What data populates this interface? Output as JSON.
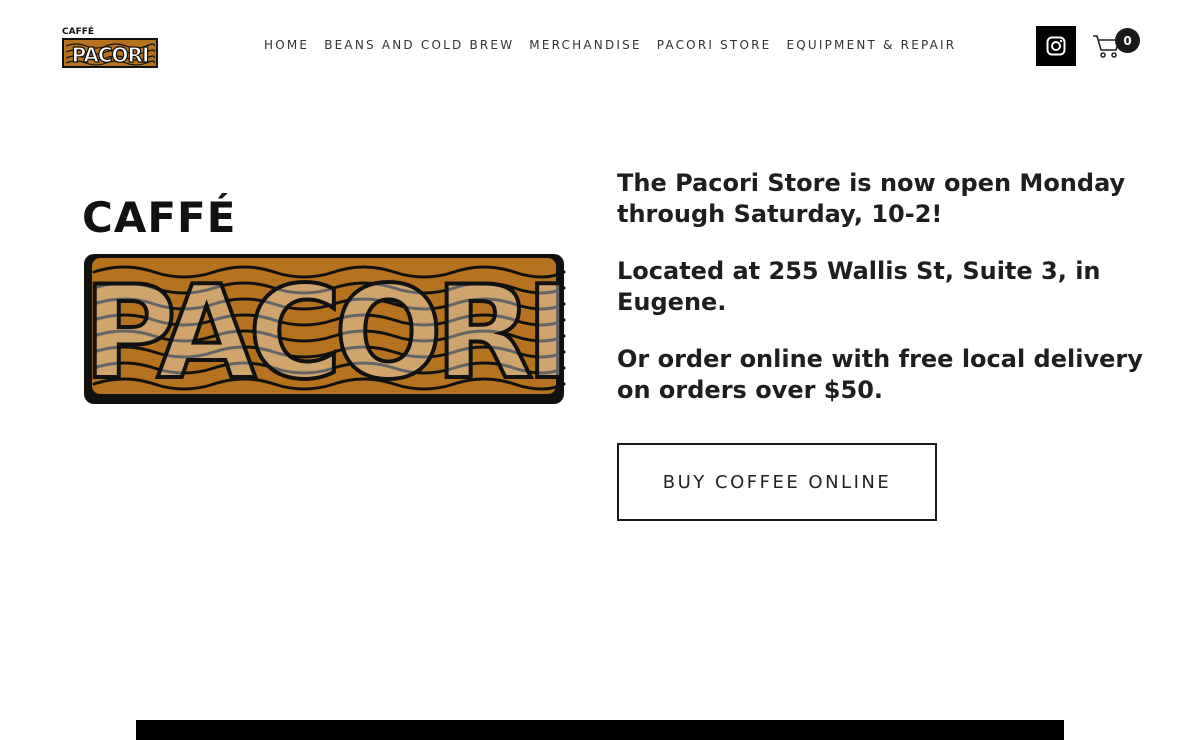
{
  "brand": {
    "logo_top_word": "CAFFÉ",
    "logo_main_word": "PACORI"
  },
  "nav": {
    "items": [
      {
        "label": "HOME"
      },
      {
        "label": "BEANS AND COLD BREW"
      },
      {
        "label": "MERCHANDISE"
      },
      {
        "label": "PACORI STORE"
      },
      {
        "label": "EQUIPMENT & REPAIR"
      }
    ]
  },
  "header": {
    "instagram_icon": "instagram-icon",
    "cart_icon": "cart-icon",
    "cart_count": "0"
  },
  "hero": {
    "paragraphs": [
      "The Pacori Store is now open Monday through Saturday, 10-2!",
      "Located at 255 Wallis St, Suite 3, in Eugene.",
      "Or order online with free local delivery on orders over $50."
    ],
    "button_label": "BUY COFFEE ONLINE"
  },
  "colors": {
    "accent_brown": "#b5731f",
    "text": "#1e1e1e",
    "black": "#000000"
  }
}
